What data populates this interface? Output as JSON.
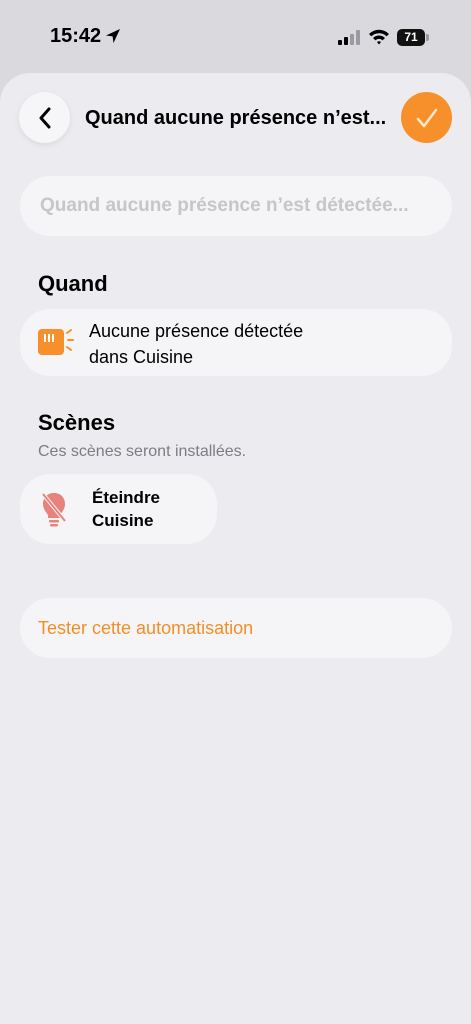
{
  "status_bar": {
    "time": "15:42",
    "battery": "71"
  },
  "nav": {
    "title": "Quand aucune présence n’est...",
    "back_icon": "chevron-left-icon",
    "confirm_icon": "checkmark-icon"
  },
  "name_field": {
    "placeholder": "Quand aucune présence n’est détectée..."
  },
  "when_section": {
    "title": "Quand",
    "trigger": {
      "icon": "presence-sensor-icon",
      "line1": "Aucune présence détectée",
      "line2": "dans Cuisine"
    }
  },
  "scenes_section": {
    "title": "Scènes",
    "subtitle": "Ces scènes seront installées.",
    "scene": {
      "icon": "bulb-off-icon",
      "line1": "Éteindre",
      "line2": "Cuisine"
    }
  },
  "test_button": {
    "label": "Tester cette automatisation"
  },
  "colors": {
    "accent": "#f7902b",
    "accent_text": "#f08f26",
    "sheet_bg": "#ebebf0",
    "card_bg": "#f5f5f7",
    "scene_icon": "#e8837c"
  }
}
